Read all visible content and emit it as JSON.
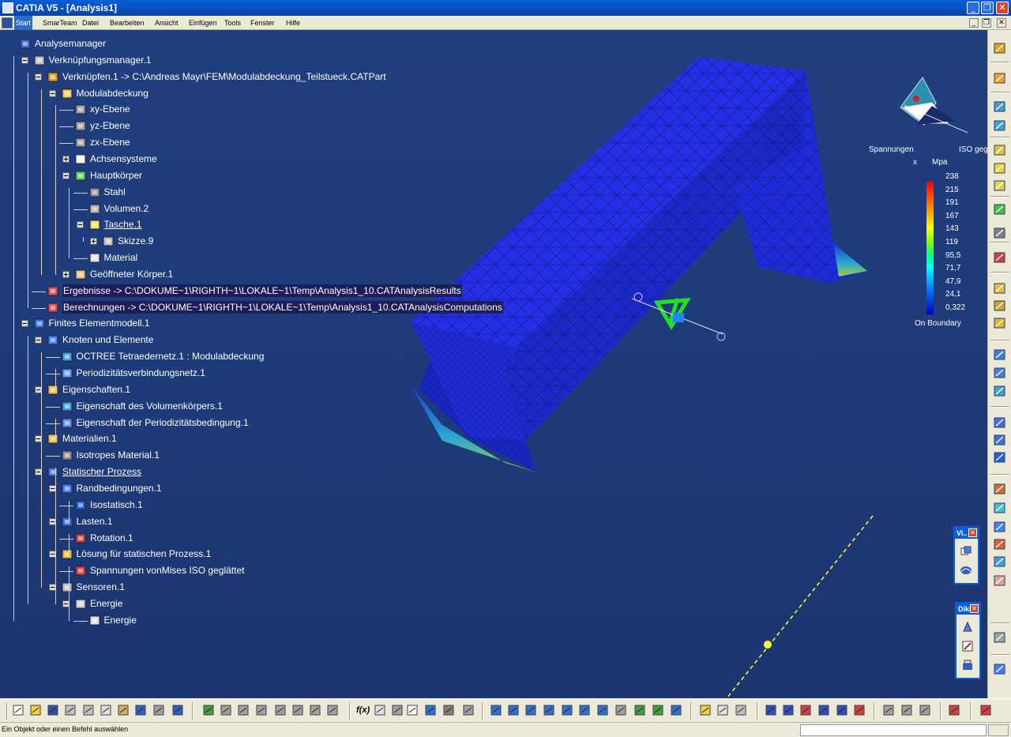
{
  "window": {
    "title": "CATIA V5 - [Analysis1]",
    "minimize": "_",
    "restore": "❐",
    "close": "✕",
    "doc_min": "_",
    "doc_restore": "❐",
    "doc_close": "✕"
  },
  "menu": [
    {
      "label": "Start",
      "active": true
    },
    {
      "label": "SmarTeam"
    },
    {
      "label": "Datei"
    },
    {
      "label": "Bearbeiten"
    },
    {
      "label": "Ansicht"
    },
    {
      "label": "Einfügen"
    },
    {
      "label": "Tools"
    },
    {
      "label": "Fenster"
    },
    {
      "label": "Hilfe"
    }
  ],
  "tree": [
    {
      "label": "Analysemanager",
      "icon": "analysis-manager-icon",
      "level": 0,
      "toggle": "none"
    },
    {
      "label": "Verknüpfungsmanager.1",
      "icon": "link-manager-icon",
      "level": 1,
      "toggle": "minus"
    },
    {
      "label": "Verknüpfen.1 -> C:\\Andreas Mayr\\FEM\\Modulabdeckung_Teilstueck.CATPart",
      "icon": "link-icon",
      "level": 2,
      "toggle": "minus"
    },
    {
      "label": "Modulabdeckung",
      "icon": "part-icon",
      "level": 3,
      "toggle": "minus"
    },
    {
      "label": "xy-Ebene",
      "icon": "plane-icon",
      "level": 4,
      "toggle": "none"
    },
    {
      "label": "yz-Ebene",
      "icon": "plane-icon",
      "level": 4,
      "toggle": "none"
    },
    {
      "label": "zx-Ebene",
      "icon": "plane-icon",
      "level": 4,
      "toggle": "none"
    },
    {
      "label": "Achsensysteme",
      "icon": "axis-system-icon",
      "level": 4,
      "toggle": "plus"
    },
    {
      "label": "Hauptkörper",
      "icon": "body-icon",
      "level": 4,
      "toggle": "minus"
    },
    {
      "label": "Stahl",
      "icon": "steel-icon",
      "level": 5,
      "toggle": "none"
    },
    {
      "label": "Volumen.2",
      "icon": "volume-icon",
      "level": 5,
      "toggle": "none"
    },
    {
      "label": "Tasche.1",
      "icon": "pocket-icon",
      "level": 5,
      "toggle": "minus",
      "underline": true
    },
    {
      "label": "Skizze.9",
      "icon": "sketch-icon",
      "level": 6,
      "toggle": "plus"
    },
    {
      "label": "Material",
      "icon": "material-icon",
      "level": 5,
      "toggle": "none"
    },
    {
      "label": "Geöffneter Körper.1",
      "icon": "open-body-icon",
      "level": 4,
      "toggle": "plus"
    },
    {
      "label": "Ergebnisse -> C:\\DOKUME~1\\RIGHTH~1\\LOKALE~1\\Temp\\Analysis1_10.CATAnalysisResults",
      "icon": "results-link-icon",
      "level": 2,
      "toggle": "none",
      "selected": true
    },
    {
      "label": "Berechnungen -> C:\\DOKUME~1\\RIGHTH~1\\LOKALE~1\\Temp\\Analysis1_10.CATAnalysisComputations",
      "icon": "computations-link-icon",
      "level": 2,
      "toggle": "none",
      "selected": true
    },
    {
      "label": "Finites Elementmodell.1",
      "icon": "fem-model-icon",
      "level": 1,
      "toggle": "minus"
    },
    {
      "label": "Knoten und Elemente",
      "icon": "nodes-elements-icon",
      "level": 2,
      "toggle": "minus"
    },
    {
      "label": "OCTREE Tetraedernetz.1 : Modulabdeckung",
      "icon": "tetra-mesh-icon",
      "level": 3,
      "toggle": "none"
    },
    {
      "label": "Periodizitätsverbindungsnetz.1",
      "icon": "periodic-mesh-icon",
      "level": 3,
      "toggle": "none"
    },
    {
      "label": "Eigenschaften.1",
      "icon": "folder-icon",
      "level": 2,
      "toggle": "minus"
    },
    {
      "label": "Eigenschaft des Volumenkörpers.1",
      "icon": "solid-property-icon",
      "level": 3,
      "toggle": "none"
    },
    {
      "label": "Eigenschaft der Periodizitätsbedingung.1",
      "icon": "periodic-property-icon",
      "level": 3,
      "toggle": "none"
    },
    {
      "label": "Materialien.1",
      "icon": "folder-icon",
      "level": 2,
      "toggle": "minus"
    },
    {
      "label": "Isotropes Material.1",
      "icon": "isotropic-material-icon",
      "level": 3,
      "toggle": "none"
    },
    {
      "label": "Statischer Prozess",
      "icon": "static-case-icon",
      "level": 2,
      "toggle": "minus",
      "underline": true
    },
    {
      "label": "Randbedingungen.1",
      "icon": "restraints-icon",
      "level": 3,
      "toggle": "minus"
    },
    {
      "label": "Isostatisch.1",
      "icon": "isostatic-icon",
      "level": 4,
      "toggle": "none"
    },
    {
      "label": "Lasten.1",
      "icon": "loads-icon",
      "level": 3,
      "toggle": "minus"
    },
    {
      "label": "Rotation.1",
      "icon": "rotation-icon",
      "level": 4,
      "toggle": "none"
    },
    {
      "label": "Lösung für statischen Prozess.1",
      "icon": "solution-icon",
      "level": 3,
      "toggle": "minus"
    },
    {
      "label": "Spannungen vonMises ISO geglättet",
      "icon": "von-mises-icon",
      "level": 4,
      "toggle": "none"
    },
    {
      "label": "Sensoren.1",
      "icon": "sensors-icon",
      "level": 3,
      "toggle": "minus"
    },
    {
      "label": "Energie",
      "icon": "energy-icon",
      "level": 4,
      "toggle": "minus"
    },
    {
      "label": "Energie",
      "icon": "energy-value-icon",
      "level": 5,
      "toggle": "none"
    }
  ],
  "legend": {
    "header_left": "Spannungen",
    "header_right": "ISO geg",
    "axis_x": "x",
    "header_sub": "Mpa",
    "values": [
      "238",
      "215",
      "191",
      "167",
      "143",
      "119",
      "95,5",
      "71,7",
      "47,9",
      "24,1",
      "0,322"
    ],
    "caption": "On Boundary",
    "colors": [
      "#ff0000",
      "#ff8000",
      "#ffff00",
      "#80ff00",
      "#00ff80",
      "#00ffff",
      "#0080ff",
      "#0000c8"
    ]
  },
  "panels": {
    "view_title": "Vi..",
    "view_close": "✕",
    "ddiag_title": "Diki",
    "ddiag_close": "✕"
  },
  "status": {
    "message": "Ein Objekt oder einen Befehl auswählen"
  },
  "colors": {
    "viewport_bg": "#1f3a76",
    "part_blue": "#1f2ad8",
    "tree_text": "#ffffff"
  }
}
